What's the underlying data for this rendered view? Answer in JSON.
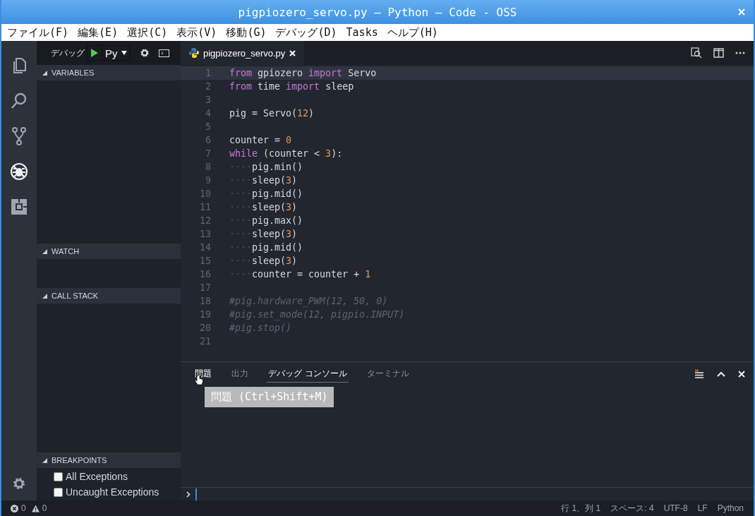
{
  "window": {
    "title": "pigpiozero_servo.py — Python — Code - OSS"
  },
  "menu": [
    "ファイル(F)",
    "編集(E)",
    "選択(C)",
    "表示(V)",
    "移動(G)",
    "デバッグ(D)",
    "Tasks",
    "ヘルプ(H)"
  ],
  "activity_bar": [
    {
      "kind": "files",
      "selected": false
    },
    {
      "kind": "search",
      "selected": false
    },
    {
      "kind": "git",
      "selected": false
    },
    {
      "kind": "debug",
      "selected": true
    },
    {
      "kind": "extensions",
      "selected": false
    }
  ],
  "debug_toolbar": {
    "label": "デバッグ",
    "config": "Py"
  },
  "sidebar_sections": [
    {
      "title": "VARIABLES",
      "expanded": true
    },
    {
      "title": "WATCH",
      "expanded": true
    },
    {
      "title": "CALL STACK",
      "expanded": true
    },
    {
      "title": "BREAKPOINTS",
      "expanded": true
    }
  ],
  "breakpoints": [
    {
      "label": "All Exceptions",
      "checked": false
    },
    {
      "label": "Uncaught Exceptions",
      "checked": false
    }
  ],
  "editor": {
    "tab": {
      "title": "pigpiozero_servo.py"
    },
    "lines": [
      {
        "number": "1",
        "current": true,
        "tokens": [
          {
            "kind": "kw",
            "t": "from"
          },
          {
            "kind": "plain",
            "t": " gpiozero "
          },
          {
            "kind": "kw",
            "t": "import"
          },
          {
            "kind": "plain",
            "t": " Servo"
          }
        ]
      },
      {
        "number": "2",
        "current": false,
        "tokens": [
          {
            "kind": "kw",
            "t": "from"
          },
          {
            "kind": "plain",
            "t": " time "
          },
          {
            "kind": "kw",
            "t": "import"
          },
          {
            "kind": "plain",
            "t": " sleep"
          }
        ]
      },
      {
        "number": "3",
        "current": false
      },
      {
        "number": "4",
        "current": false,
        "tokens": [
          {
            "kind": "plain",
            "t": "pig = Servo("
          },
          {
            "kind": "num",
            "t": "12"
          },
          {
            "kind": "plain",
            "t": ")"
          }
        ]
      },
      {
        "number": "5",
        "current": false
      },
      {
        "number": "6",
        "current": false,
        "tokens": [
          {
            "kind": "plain",
            "t": "counter = "
          },
          {
            "kind": "num",
            "t": "0"
          }
        ]
      },
      {
        "number": "7",
        "current": false,
        "tokens": [
          {
            "kind": "kw",
            "t": "while"
          },
          {
            "kind": "plain",
            "t": " (counter < "
          },
          {
            "kind": "num",
            "t": "3"
          },
          {
            "kind": "plain",
            "t": "):"
          }
        ]
      },
      {
        "number": "8",
        "current": false,
        "tokens": [
          {
            "kind": "ws",
            "t": "····"
          },
          {
            "kind": "plain",
            "t": "pig.min()"
          }
        ]
      },
      {
        "number": "9",
        "current": false,
        "tokens": [
          {
            "kind": "ws",
            "t": "····"
          },
          {
            "kind": "plain",
            "t": "sleep("
          },
          {
            "kind": "num",
            "t": "3"
          },
          {
            "kind": "plain",
            "t": ")"
          }
        ]
      },
      {
        "number": "10",
        "current": false,
        "tokens": [
          {
            "kind": "ws",
            "t": "····"
          },
          {
            "kind": "plain",
            "t": "pig.mid()"
          }
        ]
      },
      {
        "number": "11",
        "current": false,
        "tokens": [
          {
            "kind": "ws",
            "t": "····"
          },
          {
            "kind": "plain",
            "t": "sleep("
          },
          {
            "kind": "num",
            "t": "3"
          },
          {
            "kind": "plain",
            "t": ")"
          }
        ]
      },
      {
        "number": "12",
        "current": false,
        "tokens": [
          {
            "kind": "ws",
            "t": "····"
          },
          {
            "kind": "plain",
            "t": "pig.max()"
          }
        ]
      },
      {
        "number": "13",
        "current": false,
        "tokens": [
          {
            "kind": "ws",
            "t": "····"
          },
          {
            "kind": "plain",
            "t": "sleep("
          },
          {
            "kind": "num",
            "t": "3"
          },
          {
            "kind": "plain",
            "t": ")"
          }
        ]
      },
      {
        "number": "14",
        "current": false,
        "tokens": [
          {
            "kind": "ws",
            "t": "····"
          },
          {
            "kind": "plain",
            "t": "pig.mid()"
          }
        ]
      },
      {
        "number": "15",
        "current": false,
        "tokens": [
          {
            "kind": "ws",
            "t": "····"
          },
          {
            "kind": "plain",
            "t": "sleep("
          },
          {
            "kind": "num",
            "t": "3"
          },
          {
            "kind": "plain",
            "t": ")"
          }
        ]
      },
      {
        "number": "16",
        "current": false,
        "tokens": [
          {
            "kind": "ws",
            "t": "····"
          },
          {
            "kind": "plain",
            "t": "counter = counter + "
          },
          {
            "kind": "num",
            "t": "1"
          }
        ]
      },
      {
        "number": "17",
        "current": false
      },
      {
        "number": "18",
        "current": false,
        "tokens": [
          {
            "kind": "comment",
            "t": "#pig.hardware_PWM(12, 50, 0)"
          }
        ]
      },
      {
        "number": "19",
        "current": false,
        "tokens": [
          {
            "kind": "comment",
            "t": "#pig.set_mode(12, pigpio.INPUT)"
          }
        ]
      },
      {
        "number": "20",
        "current": false,
        "tokens": [
          {
            "kind": "comment",
            "t": "#pig.stop()"
          }
        ]
      },
      {
        "number": "21",
        "current": false
      }
    ]
  },
  "panel": {
    "tabs": [
      {
        "label": "問題",
        "selected": false,
        "hovered": true
      },
      {
        "label": "出力",
        "selected": false,
        "hovered": false
      },
      {
        "label": "デバッグ コンソール",
        "selected": true,
        "hovered": false
      },
      {
        "label": "ターミナル",
        "selected": false,
        "hovered": false
      }
    ],
    "tooltip": "問題 (Ctrl+Shift+M)"
  },
  "status_bar": {
    "errors": "0",
    "warnings": "0",
    "items": [
      "行 1、列 1",
      "スペース: 4",
      "UTF-8",
      "LF",
      "Python"
    ]
  }
}
